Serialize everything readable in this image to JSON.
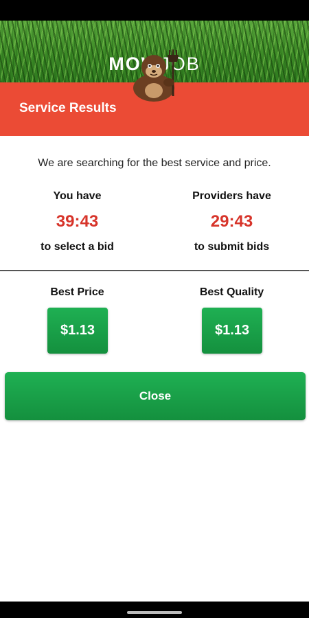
{
  "header": {
    "logo_part1": "MOW",
    "logo_part2": "JOB",
    "mascot": "gorilla-mascot-icon"
  },
  "title_bar": {
    "title": "Service Results"
  },
  "status_message": "We are searching for the best service and price.",
  "timers": {
    "user": {
      "heading": "You have",
      "time": "39:43",
      "caption": "to select a bid"
    },
    "providers": {
      "heading": "Providers have",
      "time": "29:43",
      "caption": "to submit bids"
    }
  },
  "bids": {
    "best_price": {
      "label": "Best Price",
      "amount": "$1.13"
    },
    "best_quality": {
      "label": "Best Quality",
      "amount": "$1.13"
    }
  },
  "close_label": "Close",
  "colors": {
    "title_bar": "#eb4b35",
    "timer_text": "#d7342a",
    "button_green": "#14903e"
  }
}
